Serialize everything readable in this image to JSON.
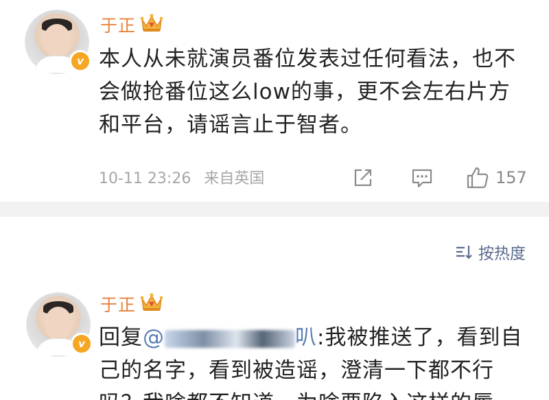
{
  "post": {
    "username": "于正",
    "content_lines": [
      "本人从未就演员番位发表过任何看法，也不",
      "会做抢番位这么low的事，更不会左右片方",
      "和平台，请谣言止于智者。"
    ],
    "timestamp": "10-11 23:26",
    "source": "来自英国",
    "like_count": "157"
  },
  "comments_header": {
    "sort_label": "按热度"
  },
  "reply": {
    "username": "于正",
    "prefix": "回复",
    "mention_suffix": "叭",
    "content_after_mention": ":我被推送了，看到自",
    "content_lines": [
      "己的名字，看到被造谣，澄清一下都不行",
      "吗？我啥都不知道，为啥要陷入这样的辱"
    ]
  },
  "colors": {
    "username": "#e8823c",
    "verified_badge": "#f5a623",
    "meta_text": "#a6a6a6",
    "sort_link": "#5a6b8c",
    "divider": "#f2f2f2"
  },
  "icons": {
    "verified": "verified-v-icon",
    "member_crown": "crown-icon",
    "share": "share-icon",
    "comment": "comment-icon",
    "like": "thumbs-up-icon",
    "sort": "sort-icon"
  }
}
